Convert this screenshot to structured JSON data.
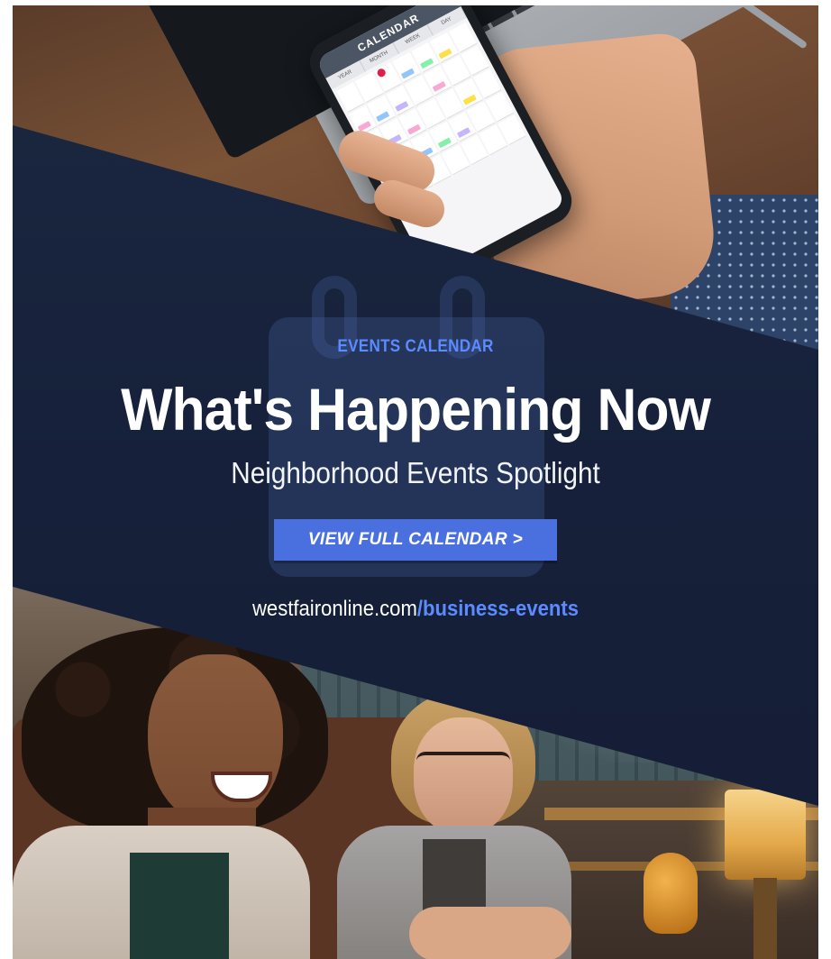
{
  "colors": {
    "band": "#1b2740",
    "accent": "#4a70e0",
    "accent_text": "#5b8bff",
    "white": "#ffffff"
  },
  "phone_calendar": {
    "header": "CALENDAR",
    "tabs": [
      "YEAR",
      "MONTH",
      "WEEK",
      "DAY"
    ]
  },
  "banner": {
    "kicker": "EVENTS CALENDAR",
    "headline": "What's Happening Now",
    "subhead": "Neighborhood Events Spotlight",
    "cta_label": "VIEW FULL CALENDAR >",
    "url_domain": "westfaironline.com",
    "url_path": "/business-events"
  },
  "icons": {
    "background": "calendar-icon"
  }
}
